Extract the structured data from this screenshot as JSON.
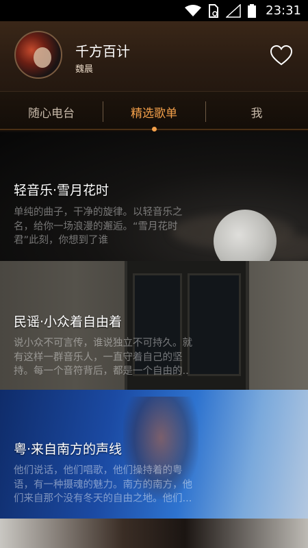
{
  "status_bar": {
    "time": "23:31"
  },
  "profile": {
    "name": "千方百计",
    "subtitle": "魏晨"
  },
  "tabs": [
    {
      "label": "随心电台",
      "active": false
    },
    {
      "label": "精选歌单",
      "active": true
    },
    {
      "label": "我",
      "active": false
    }
  ],
  "playlists": [
    {
      "title": "轻音乐·雪月花时",
      "description_lines": [
        "单纯的曲子，干净的旋律。以轻音乐之",
        "名，给你一场浪漫的邂逅。“雪月花时",
        "君”此刻，你想到了谁"
      ]
    },
    {
      "title": "民谣·小众着自由着",
      "description_lines": [
        "说小众不可言传，谁说独立不可持久。就",
        "有这样一群音乐人，一直守着自己的坚",
        "持。每一个音符背后，都是一个自由的.."
      ]
    },
    {
      "title": "粤·来自南方的声线",
      "description_lines": [
        "他们说话，他们唱歌，他们操持着的粤",
        "语，有一种摄魂的魅力。南方的南方，他",
        "们来自那个没有冬天的自由之地。他们..."
      ]
    }
  ],
  "colors": {
    "accent": "#f4a04a",
    "header_bg": "#2a1c12"
  },
  "icons": {
    "heart": "heart-outline-icon",
    "wifi": "wifi-icon",
    "sim": "sim-card-icon",
    "signal": "signal-icon",
    "battery": "battery-icon"
  }
}
